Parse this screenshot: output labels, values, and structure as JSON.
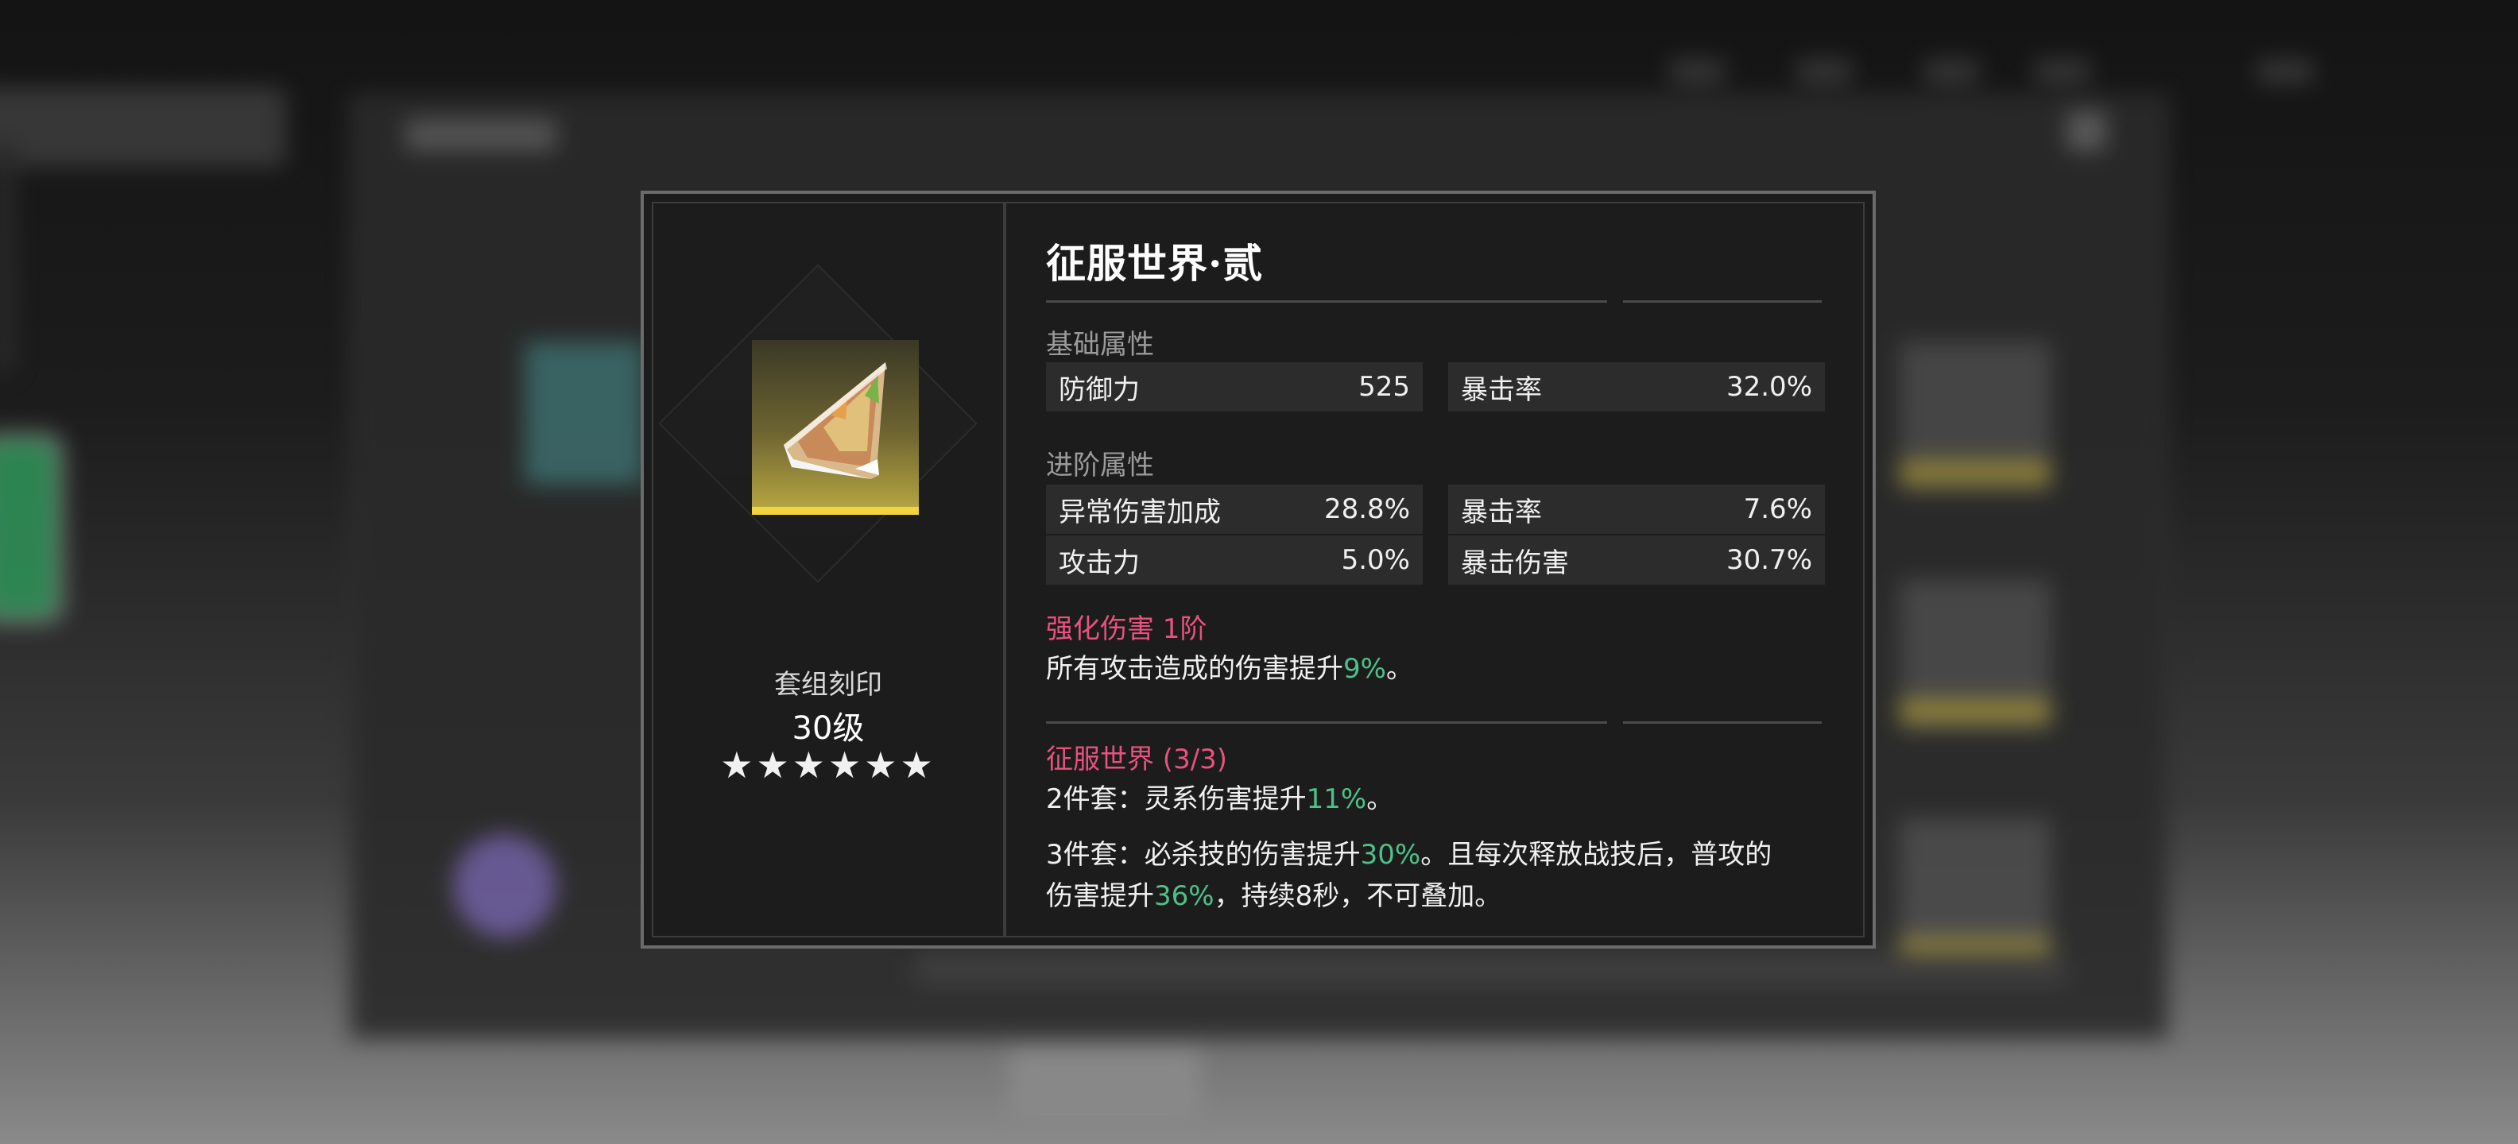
{
  "item": {
    "title": "征服世界·贰",
    "set_label": "套组刻印",
    "level": "30级",
    "stars": "★★★★★★",
    "star_count": 6,
    "icon": "disc-shard-icon"
  },
  "base_stats": {
    "label": "基础属性",
    "rows": [
      [
        {
          "name": "防御力",
          "value": "525"
        },
        {
          "name": "暴击率",
          "value": "32.0%"
        }
      ]
    ]
  },
  "advanced_stats": {
    "label": "进阶属性",
    "rows": [
      [
        {
          "name": "异常伤害加成",
          "value": "28.8%"
        },
        {
          "name": "暴击率",
          "value": "7.6%"
        }
      ],
      [
        {
          "name": "攻击力",
          "value": "5.0%"
        },
        {
          "name": "暴击伤害",
          "value": "30.7%"
        }
      ]
    ]
  },
  "enhance": {
    "header": "强化伤害 1阶",
    "desc_pre": "所有攻击造成的伤害提升",
    "desc_val": "9%",
    "desc_post": "。"
  },
  "set_bonus": {
    "header": "征服世界 (3/3)",
    "two_piece": {
      "pre": "2件套：灵系伤害提升",
      "val": "11%",
      "post": "。"
    },
    "three_piece": {
      "line1_pre": "3件套：必杀技的伤害提升",
      "line1_val": "30%",
      "line1_post": "。且每次释放战技后，普攻的",
      "line2_pre": "伤害提升",
      "line2_val": "36%",
      "line2_post": "，持续8秒，不可叠加。"
    }
  },
  "colors": {
    "accent_pink": "#e8527f",
    "value_green": "#4ec08a",
    "icon_gold": "#f2d53c"
  }
}
